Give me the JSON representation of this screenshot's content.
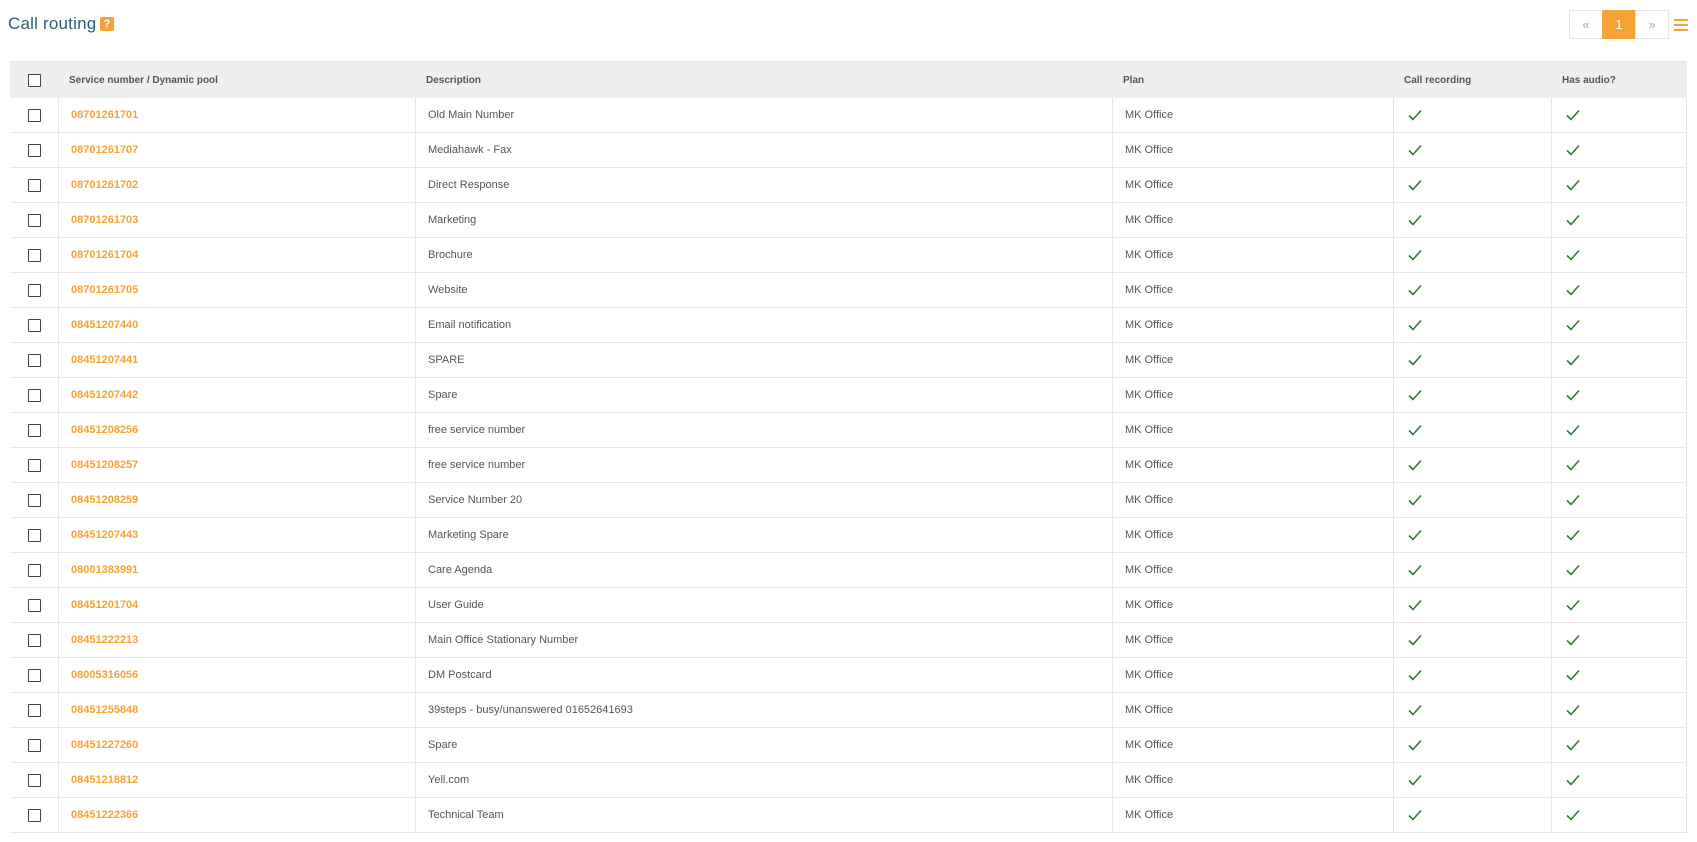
{
  "header": {
    "title": "Call routing",
    "help_icon": "?"
  },
  "pagination": {
    "prev": "«",
    "current": "1",
    "next": "»"
  },
  "colors": {
    "accent": "#f7a235",
    "title": "#2c5f73",
    "check": "#2e7d32"
  },
  "table": {
    "columns": [
      "Service number / Dynamic pool",
      "Description",
      "Plan",
      "Call recording",
      "Has audio?"
    ],
    "rows": [
      {
        "number": "08701261701",
        "description": "Old Main Number",
        "plan": "MK Office",
        "recording": true,
        "audio": true
      },
      {
        "number": "08701261707",
        "description": "Mediahawk - Fax",
        "plan": "MK Office",
        "recording": true,
        "audio": true
      },
      {
        "number": "08701261702",
        "description": "Direct Response",
        "plan": "MK Office",
        "recording": true,
        "audio": true
      },
      {
        "number": "08701261703",
        "description": "Marketing",
        "plan": "MK Office",
        "recording": true,
        "audio": true
      },
      {
        "number": "08701261704",
        "description": "Brochure",
        "plan": "MK Office",
        "recording": true,
        "audio": true
      },
      {
        "number": "08701261705",
        "description": "Website",
        "plan": "MK Office",
        "recording": true,
        "audio": true
      },
      {
        "number": "08451207440",
        "description": "Email notification",
        "plan": "MK Office",
        "recording": true,
        "audio": true
      },
      {
        "number": "08451207441",
        "description": "SPARE",
        "plan": "MK Office",
        "recording": true,
        "audio": true
      },
      {
        "number": "08451207442",
        "description": "Spare",
        "plan": "MK Office",
        "recording": true,
        "audio": true
      },
      {
        "number": "08451208256",
        "description": "free service number",
        "plan": "MK Office",
        "recording": true,
        "audio": true
      },
      {
        "number": "08451208257",
        "description": "free service number",
        "plan": "MK Office",
        "recording": true,
        "audio": true
      },
      {
        "number": "08451208259",
        "description": "Service Number 20",
        "plan": "MK Office",
        "recording": true,
        "audio": true
      },
      {
        "number": "08451207443",
        "description": "Marketing Spare",
        "plan": "MK Office",
        "recording": true,
        "audio": true
      },
      {
        "number": "08001383991",
        "description": "Care Agenda",
        "plan": "MK Office",
        "recording": true,
        "audio": true
      },
      {
        "number": "08451201704",
        "description": "User Guide",
        "plan": "MK Office",
        "recording": true,
        "audio": true
      },
      {
        "number": "08451222213",
        "description": "Main Office Stationary Number",
        "plan": "MK Office",
        "recording": true,
        "audio": true
      },
      {
        "number": "08005316056",
        "description": "DM Postcard",
        "plan": "MK Office",
        "recording": true,
        "audio": true
      },
      {
        "number": "08451255848",
        "description": "39steps - busy/unanswered 01652641693",
        "plan": "MK Office",
        "recording": true,
        "audio": true
      },
      {
        "number": "08451227260",
        "description": "Spare",
        "plan": "MK Office",
        "recording": true,
        "audio": true
      },
      {
        "number": "08451218812",
        "description": "Yell.com",
        "plan": "MK Office",
        "recording": true,
        "audio": true
      },
      {
        "number": "08451222366",
        "description": "Technical Team",
        "plan": "MK Office",
        "recording": true,
        "audio": true
      }
    ]
  }
}
